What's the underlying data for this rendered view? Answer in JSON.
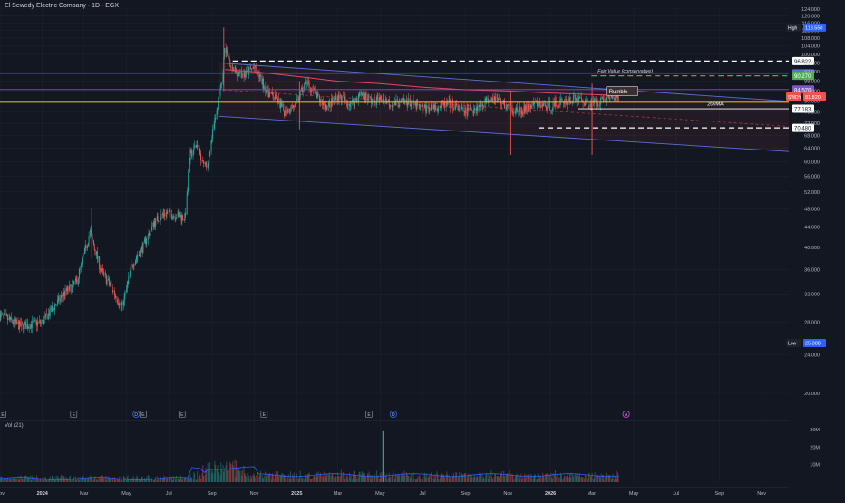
{
  "header": {
    "title": "El Sewedy Electric Company · 1D · EGX"
  },
  "volume": {
    "label": "Vol (21)"
  },
  "colors": {
    "background": "#131722",
    "grid": "#1e222d",
    "text": "#b2b5be",
    "up": "#26a69a",
    "down": "#ef5350",
    "channel": "#5b6fd6",
    "orange": "#f7a21b",
    "ma200": "#e0486b",
    "level_purple": "#7e57c2"
  },
  "chart_data": {
    "type": "candlestick",
    "title": "El Sewedy Electric Company · 1D · EGX",
    "yscale": "log",
    "ylim": [
      18.5,
      125
    ],
    "y_ticks": [
      20,
      24,
      28,
      32,
      36,
      40,
      44,
      48,
      52,
      56,
      60,
      64,
      68,
      72,
      76,
      80,
      84,
      88,
      92,
      96,
      100,
      104,
      108,
      112,
      116,
      120,
      124
    ],
    "y_tick_labels": [
      "20.000",
      "24.000",
      "28.000",
      "32.000",
      "36.000",
      "40.000",
      "44.000",
      "48.000",
      "52.000",
      "56.000",
      "60.000",
      "64.000",
      "68.000",
      "72.000",
      "76.000",
      "80.000",
      "84.000",
      "88.000",
      "92.000",
      "96.000",
      "100.000",
      "104.000",
      "108.000",
      "112.000",
      "116.000",
      "120.000",
      "124.000"
    ],
    "xlim": [
      "2023-11-01",
      "2026-12-10"
    ],
    "x_ticks": [
      {
        "date": "2023-11-01",
        "label": "Nov",
        "bold": false
      },
      {
        "date": "2024-01-01",
        "label": "2024",
        "bold": true
      },
      {
        "date": "2024-03-01",
        "label": "Mar",
        "bold": false
      },
      {
        "date": "2024-05-01",
        "label": "May",
        "bold": false
      },
      {
        "date": "2024-07-01",
        "label": "Jul",
        "bold": false
      },
      {
        "date": "2024-09-01",
        "label": "Sep",
        "bold": false
      },
      {
        "date": "2024-11-01",
        "label": "Nov",
        "bold": false
      },
      {
        "date": "2025-01-01",
        "label": "2025",
        "bold": true
      },
      {
        "date": "2025-03-01",
        "label": "Mar",
        "bold": false
      },
      {
        "date": "2025-05-01",
        "label": "May",
        "bold": false
      },
      {
        "date": "2025-07-01",
        "label": "Jul",
        "bold": false
      },
      {
        "date": "2025-09-01",
        "label": "Sep",
        "bold": false
      },
      {
        "date": "2025-11-01",
        "label": "Nov",
        "bold": false
      },
      {
        "date": "2026-01-01",
        "label": "2026",
        "bold": true
      },
      {
        "date": "2026-03-01",
        "label": "Mar",
        "bold": false
      },
      {
        "date": "2026-05-01",
        "label": "May",
        "bold": false
      },
      {
        "date": "2026-07-01",
        "label": "Jul",
        "bold": false
      },
      {
        "date": "2026-09-01",
        "label": "Sep",
        "bold": false
      },
      {
        "date": "2026-11-01",
        "label": "Nov",
        "bold": false
      }
    ],
    "price_path": [
      [
        "2023-11-01",
        29
      ],
      [
        "2023-12-01",
        27.5
      ],
      [
        "2024-01-01",
        28
      ],
      [
        "2024-02-01",
        32
      ],
      [
        "2024-02-20",
        34
      ],
      [
        "2024-03-10",
        43
      ],
      [
        "2024-03-25",
        36
      ],
      [
        "2024-04-10",
        33
      ],
      [
        "2024-04-25",
        30
      ],
      [
        "2024-05-10",
        37
      ],
      [
        "2024-05-25",
        40
      ],
      [
        "2024-06-10",
        45
      ],
      [
        "2024-06-25",
        47
      ],
      [
        "2024-07-15",
        46.5
      ],
      [
        "2024-07-25",
        46
      ],
      [
        "2024-08-01",
        62
      ],
      [
        "2024-08-10",
        65
      ],
      [
        "2024-08-25",
        58
      ],
      [
        "2024-09-05",
        72
      ],
      [
        "2024-09-15",
        86
      ],
      [
        "2024-09-20",
        104
      ],
      [
        "2024-10-01",
        93
      ],
      [
        "2024-10-15",
        90
      ],
      [
        "2024-11-01",
        94
      ],
      [
        "2024-11-20",
        84
      ],
      [
        "2024-12-05",
        80
      ],
      [
        "2024-12-15",
        76
      ],
      [
        "2025-01-01",
        79
      ],
      [
        "2025-01-15",
        88
      ],
      [
        "2025-02-01",
        81
      ],
      [
        "2025-02-15",
        78
      ],
      [
        "2025-03-01",
        82
      ],
      [
        "2025-03-20",
        79
      ],
      [
        "2025-04-05",
        83
      ],
      [
        "2025-04-20",
        80
      ],
      [
        "2025-05-05",
        81
      ],
      [
        "2025-05-20",
        79
      ],
      [
        "2025-06-10",
        80
      ],
      [
        "2025-07-01",
        77
      ],
      [
        "2025-07-20",
        78
      ],
      [
        "2025-08-10",
        79
      ],
      [
        "2025-09-01",
        76
      ],
      [
        "2025-09-20",
        78
      ],
      [
        "2025-10-10",
        82
      ],
      [
        "2025-11-01",
        78
      ],
      [
        "2025-11-20",
        76
      ],
      [
        "2025-12-10",
        79
      ],
      [
        "2026-01-01",
        78
      ],
      [
        "2026-01-20",
        80
      ],
      [
        "2026-02-10",
        81
      ],
      [
        "2026-03-01",
        79
      ],
      [
        "2026-03-20",
        81
      ],
      [
        "2026-04-10",
        81.82
      ]
    ],
    "spikes": [
      {
        "date": "2024-09-18",
        "high": 113.55,
        "low": 84
      },
      {
        "date": "2024-03-12",
        "high": 48,
        "low": 38
      },
      {
        "date": "2025-11-05",
        "high": 84,
        "low": 62
      },
      {
        "date": "2026-03-02",
        "high": 87,
        "low": 62
      },
      {
        "date": "2025-01-05",
        "high": 88,
        "low": 70
      }
    ],
    "moving_average": {
      "label": "200MA",
      "points": [
        [
          "2024-09-20",
          93
        ],
        [
          "2024-11-01",
          92
        ],
        [
          "2025-01-01",
          90
        ],
        [
          "2025-03-01",
          88
        ],
        [
          "2025-05-01",
          87
        ],
        [
          "2025-07-01",
          85.5
        ],
        [
          "2025-09-01",
          84.5
        ],
        [
          "2025-11-01",
          84
        ],
        [
          "2026-01-01",
          83.2
        ],
        [
          "2026-03-01",
          82.6
        ],
        [
          "2026-04-12",
          82.2
        ]
      ]
    },
    "channel_lines": [
      {
        "points": [
          [
            "2024-09-10",
            96
          ],
          [
            "2026-12-10",
            80
          ]
        ]
      },
      {
        "points": [
          [
            "2024-09-10",
            74.5
          ],
          [
            "2026-12-10",
            63
          ]
        ]
      }
    ],
    "horizontal_levels": [
      {
        "value": 96.822,
        "label": "96.822",
        "style": "dashed",
        "color": "#ffffff",
        "from": "2024-10-01"
      },
      {
        "value": 91.341,
        "label": "91.341",
        "style": "solid",
        "color": "#5b6fd6",
        "from": "2023-11-01"
      },
      {
        "value": 90.27,
        "label": "90.270",
        "style": "dashed",
        "color": "#4caf50",
        "from": "2026-03-01"
      },
      {
        "value": 84.57,
        "label": "84.570",
        "style": "solid",
        "color": "#7e57c2",
        "from": "2023-11-01"
      },
      {
        "value": 79.8,
        "label": "",
        "style": "solid",
        "color": "#f7a21b",
        "from": "2023-11-01"
      },
      {
        "value": 77.183,
        "label": "77.183",
        "style": "solid",
        "color": "#ffffff",
        "from": "2026-02-10"
      },
      {
        "value": 70.48,
        "label": "70.480",
        "style": "dashed",
        "color": "#ffffff",
        "from": "2025-12-15"
      }
    ],
    "price_labels": [
      {
        "name": "high",
        "prefix": "High",
        "value": 113.55,
        "text": "113.550",
        "bg": "#2962ff",
        "color": "#ffffff"
      },
      {
        "name": "current",
        "prefix": "SWDY",
        "value": 81.82,
        "text": "81.820",
        "bg": "#ef5350",
        "color": "#ffffff"
      },
      {
        "name": "low",
        "prefix": "Low",
        "value": 25.388,
        "text": "25.388",
        "bg": "#2962ff",
        "color": "#ffffff"
      }
    ],
    "annotations": [
      {
        "text": "Fair Value (conservative)",
        "date": "2026-03-10",
        "value": 91.6,
        "color": "#d1d4dc"
      },
      {
        "text": "Rumble",
        "date": "2026-03-25",
        "value": 83.6,
        "color": "#ffffff",
        "bg": "#3b2f2f"
      },
      {
        "text": "200MA",
        "date": "2026-08-15",
        "value": 78.3,
        "color": "#ffffff"
      }
    ],
    "event_markers": [
      {
        "date": "2023-11-05",
        "letter": "E"
      },
      {
        "date": "2024-02-15",
        "letter": "E"
      },
      {
        "date": "2024-05-15",
        "letter": "D"
      },
      {
        "date": "2024-05-25",
        "letter": "E"
      },
      {
        "date": "2024-07-20",
        "letter": "E"
      },
      {
        "date": "2024-11-15",
        "letter": "E"
      },
      {
        "date": "2025-04-15",
        "letter": "E"
      },
      {
        "date": "2025-05-20",
        "letter": "D"
      },
      {
        "date": "2026-04-20",
        "letter": "A"
      }
    ],
    "volume": {
      "label": "Vol (21)",
      "ylim": [
        0,
        32
      ],
      "y_ticks": [
        10,
        20,
        30
      ],
      "y_tick_labels": [
        "10M",
        "20M",
        "30M"
      ],
      "big_spike": {
        "date": "2025-05-05",
        "value": 29
      }
    }
  }
}
